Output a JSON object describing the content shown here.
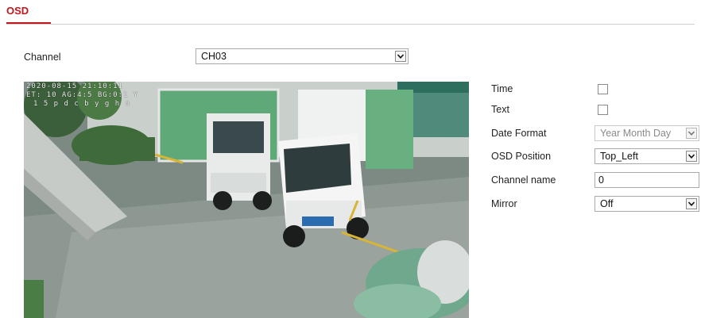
{
  "tabs": [
    {
      "label": "OSD"
    }
  ],
  "channel": {
    "label": "Channel",
    "value": "CH03"
  },
  "preview": {
    "osd_lines": [
      "2020-08-15 21:10:11",
      "ET: 10 AG:4:5 BG:0:1 Y",
      "1 5 p d c b y g h n"
    ],
    "accent_color": "#c0161d"
  },
  "settings": {
    "time": {
      "label": "Time",
      "checked": false
    },
    "text": {
      "label": "Text",
      "checked": false
    },
    "date_format": {
      "label": "Date Format",
      "value": "Year Month Day"
    },
    "osd_position": {
      "label": "OSD Position",
      "value": "Top_Left"
    },
    "channel_name": {
      "label": "Channel name",
      "value": "0"
    },
    "mirror": {
      "label": "Mirror",
      "value": "Off"
    }
  },
  "icons": {
    "dropdown": "chevron-down-icon"
  }
}
